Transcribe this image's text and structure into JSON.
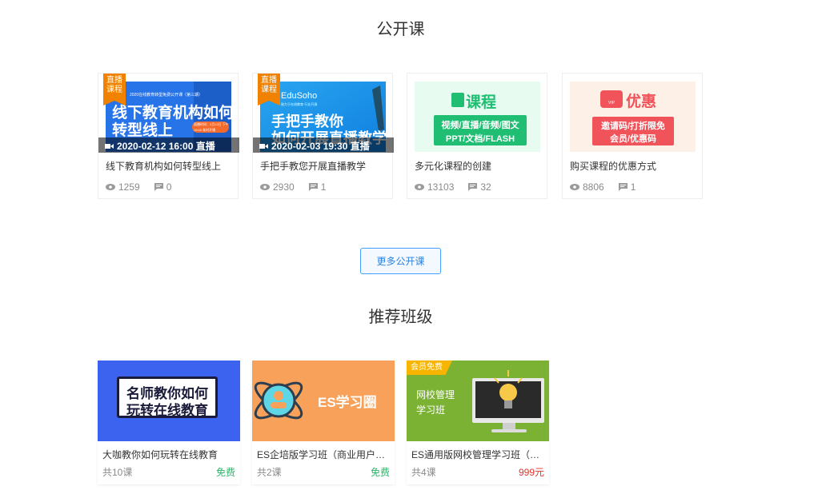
{
  "open_section": {
    "title": "公开课",
    "more_label": "更多公开课",
    "cards": [
      {
        "live_badge": [
          "直播",
          "课程"
        ],
        "banner_small": "2020在线教育转型免费公开课（第三期）",
        "banner_lines": [
          "线下教育机构如何",
          "转型线上"
        ],
        "banner_pill": "直播时间：2月12日 下午 16:00 准时开播",
        "live_label": "2020-02-12 16:00 直播",
        "title": "线下教育机构如何转型线上",
        "views": "1259",
        "comments": "0"
      },
      {
        "live_badge": [
          "直播",
          "课程"
        ],
        "banner_logo": "EduSoho",
        "banner_small": "致力于在线教育·行业开源",
        "banner_lines": [
          "手把手教你",
          "如何开展直播教学"
        ],
        "live_label": "2020-02-03 19:30 直播",
        "title": "手把手教您开展直播教学",
        "views": "2930",
        "comments": "1"
      },
      {
        "banner_heading": "课程",
        "banner_lines": [
          "视频/直播/音频/图文",
          "PPT/文档/FLASH"
        ],
        "title": "多元化课程的创建",
        "views": "13103",
        "comments": "32"
      },
      {
        "banner_heading": "优惠",
        "banner_tag": "VIP",
        "banner_lines": [
          "邀请码/打折限免",
          "会员/优惠码"
        ],
        "title": "购买课程的优惠方式",
        "views": "8806",
        "comments": "1"
      }
    ]
  },
  "class_section": {
    "title": "推荐班级",
    "cards": [
      {
        "banner_lines": [
          "名师教你如何",
          "玩转在线教育"
        ],
        "title": "大咖教你如何玩转在线教育",
        "count": "共10课",
        "price": "免费"
      },
      {
        "banner_text": "ES学习圈",
        "title": "ES企培版学习班（商业用户…",
        "count": "共2课",
        "price": "免费"
      },
      {
        "member_badge": "会员免费",
        "banner_lines": [
          "网校管理",
          "学习班"
        ],
        "title": "ES通用版网校管理学习班（…",
        "count": "共4课",
        "price": "999元"
      }
    ]
  }
}
